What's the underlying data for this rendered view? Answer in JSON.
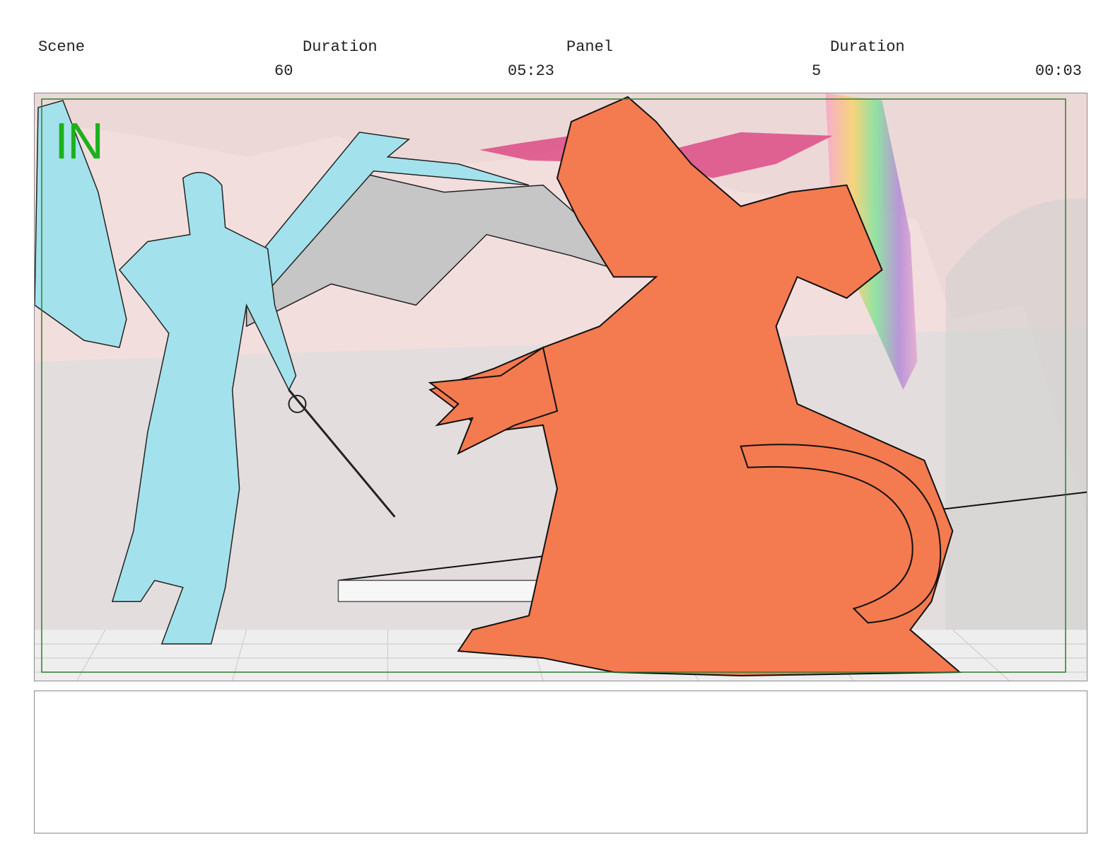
{
  "header": {
    "scene_label": "Scene",
    "scene_duration_label": "Duration",
    "panel_label": "Panel",
    "panel_duration_label": "Duration",
    "scene_value": "60",
    "scene_duration_value": "05:23",
    "panel_value": "5",
    "panel_duration_value": "00:03"
  },
  "panel": {
    "transition_mark": "IN"
  },
  "colors": {
    "safe_frame": "#2f7d2f",
    "transition_mark": "#1db01d",
    "left_character": "#a3e2ec",
    "right_character": "#f47a4f",
    "background_wash": "#f3dede"
  },
  "notes": {
    "text": ""
  }
}
